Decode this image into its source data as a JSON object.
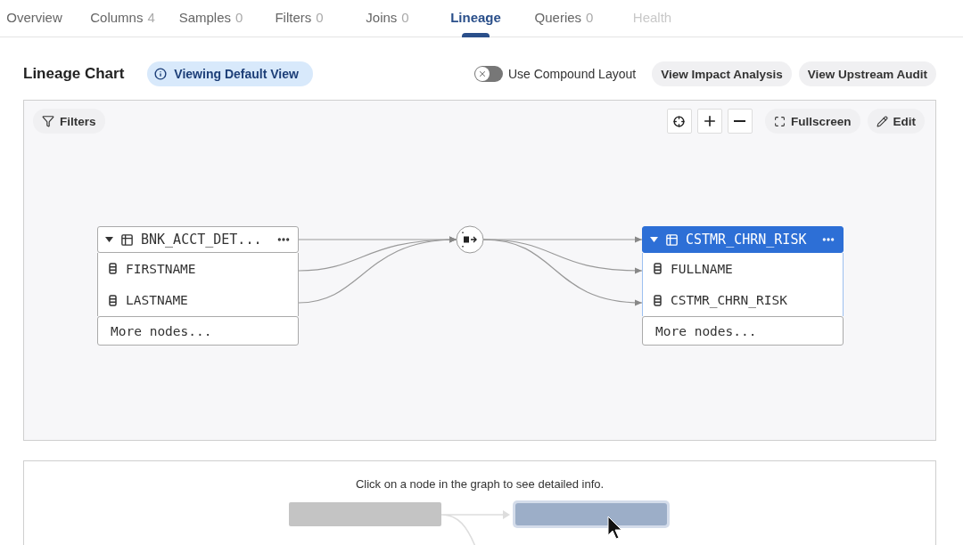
{
  "tabs": [
    {
      "label": "Overview",
      "selected": false,
      "disabled": false
    },
    {
      "label": "Columns",
      "count": "4",
      "selected": false,
      "disabled": false
    },
    {
      "label": "Samples",
      "count": "0",
      "selected": false,
      "disabled": false
    },
    {
      "label": "Filters",
      "count": "0",
      "selected": false,
      "disabled": false
    },
    {
      "label": "Joins",
      "count": "0",
      "selected": false,
      "disabled": false
    },
    {
      "label": "Lineage",
      "selected": true,
      "disabled": false
    },
    {
      "label": "Queries",
      "count": "0",
      "selected": false,
      "disabled": false
    },
    {
      "label": "Health",
      "selected": false,
      "disabled": true
    }
  ],
  "header": {
    "title": "Lineage Chart",
    "view_badge": "Viewing Default View",
    "toggle": {
      "label": "Use Compound Layout",
      "on": false
    },
    "buttons": [
      "View Impact Analysis",
      "View Upstream Audit"
    ]
  },
  "chart": {
    "filters_button": "Filters",
    "fullscreen_button": "Fullscreen",
    "edit_button": "Edit",
    "nodes": [
      {
        "title": "BNK_ACCT_DET...",
        "selected": false,
        "columns": [
          "FIRSTNAME",
          "LASTNAME"
        ],
        "more": "More nodes..."
      },
      {
        "title": "CSTMR_CHRN_RISK",
        "selected": true,
        "columns": [
          "FULLNAME",
          "CSTMR_CHRN_RISK"
        ],
        "more": "More nodes..."
      }
    ]
  },
  "details": {
    "message": "Click on a node in the graph to see detailed info."
  }
}
